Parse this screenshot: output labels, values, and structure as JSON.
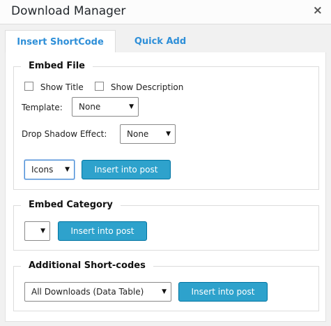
{
  "window": {
    "title": "Download Manager",
    "close_icon": "×"
  },
  "tabs": [
    {
      "label": "Insert ShortCode",
      "active": true
    },
    {
      "label": "Quick Add",
      "active": false
    }
  ],
  "embed_file": {
    "legend": "Embed File",
    "show_title_label": "Show Title",
    "show_description_label": "Show Description",
    "template_label": "Template:",
    "template_value": "None",
    "shadow_label": "Drop Shadow Effect:",
    "shadow_value": "None",
    "style_value": "Icons",
    "insert_label": "Insert into post"
  },
  "embed_category": {
    "legend": "Embed Category",
    "category_value": "",
    "insert_label": "Insert into post"
  },
  "additional": {
    "legend": "Additional Short-codes",
    "shortcode_value": "All Downloads (Data Table)",
    "insert_label": "Insert into post"
  },
  "colors": {
    "accent": "#2ea2cc",
    "tab_text": "#2e8fd8"
  }
}
